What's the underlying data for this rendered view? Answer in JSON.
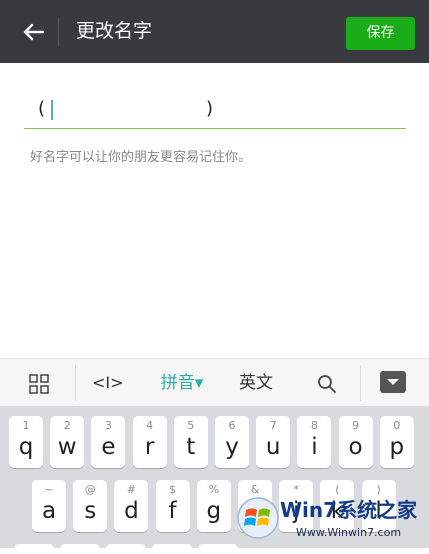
{
  "header": {
    "title": "更改名字",
    "save_label": "保存"
  },
  "input": {
    "paren_left": "(",
    "paren_right": ")"
  },
  "hint": "好名字可以让你的朋友更容易记住你。",
  "keyboard": {
    "toolbar": {
      "cursor_label": "<I>",
      "pinyin_label": "拼音▾",
      "english_label": "英文"
    },
    "row1": [
      {
        "sub": "1",
        "main": "q"
      },
      {
        "sub": "2",
        "main": "w"
      },
      {
        "sub": "3",
        "main": "e"
      },
      {
        "sub": "4",
        "main": "r"
      },
      {
        "sub": "5",
        "main": "t"
      },
      {
        "sub": "6",
        "main": "y"
      },
      {
        "sub": "7",
        "main": "u"
      },
      {
        "sub": "8",
        "main": "i"
      },
      {
        "sub": "9",
        "main": "o"
      },
      {
        "sub": "0",
        "main": "p"
      }
    ],
    "row2": [
      {
        "sub": "~",
        "main": "a"
      },
      {
        "sub": "@",
        "main": "s"
      },
      {
        "sub": "#",
        "main": "d"
      },
      {
        "sub": "$",
        "main": "f"
      },
      {
        "sub": "%",
        "main": "g"
      },
      {
        "sub": "&",
        "main": "h"
      },
      {
        "sub": "*",
        "main": "j"
      },
      {
        "sub": "(",
        "main": "k"
      },
      {
        "sub": ")",
        "main": "l"
      }
    ]
  },
  "watermark": {
    "title": "Win7系统之家",
    "url": "Www.Winwin7.com"
  },
  "colors": {
    "topbar": "#393a3f",
    "save_button": "#1aad19",
    "input_underline": "#8bc34a",
    "pinyin_accent": "#2bb0a8"
  }
}
